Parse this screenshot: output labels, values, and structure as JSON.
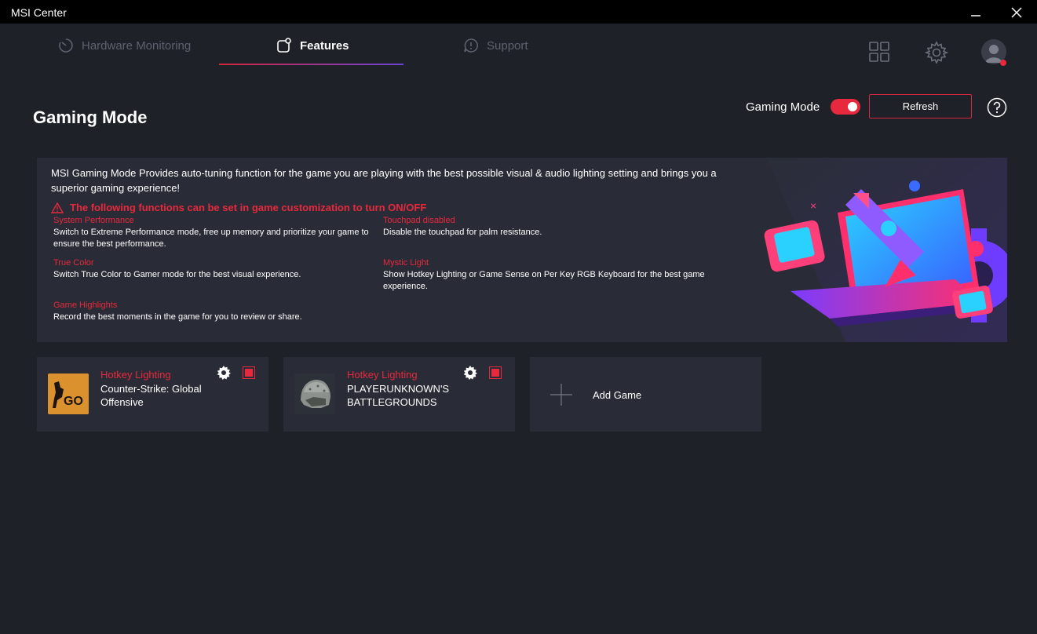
{
  "window": {
    "title": "MSI Center"
  },
  "nav": {
    "tabs": [
      {
        "label": "Hardware Monitoring",
        "active": false
      },
      {
        "label": "Features",
        "active": true
      },
      {
        "label": "Support",
        "active": false
      }
    ]
  },
  "page": {
    "title": "Gaming Mode",
    "toggle_label": "Gaming Mode",
    "toggle_on": true,
    "refresh_label": "Refresh"
  },
  "info": {
    "description": "MSI Gaming Mode Provides auto-tuning function for the game you are playing with the best possible visual & audio lighting setting and brings you a superior gaming experience!",
    "warning": "The following functions can be set in game customization to turn ON/OFF",
    "features": [
      {
        "title": "System Performance",
        "desc": "Switch to Extreme Performance mode, free up memory and prioritize your game to ensure the best performance."
      },
      {
        "title": "Touchpad disabled",
        "desc": "Disable the touchpad for palm resistance."
      },
      {
        "title": "True Color",
        "desc": "Switch True Color to Gamer mode for the best visual experience."
      },
      {
        "title": "Mystic Light",
        "desc": "Show Hotkey Lighting or Game Sense on Per Key RGB Keyboard for the best game experience."
      },
      {
        "title": "Game Highlights",
        "desc": "Record the best moments in the game for you to review or share."
      }
    ]
  },
  "games": [
    {
      "tag": "Hotkey Lighting",
      "name": "Counter-Strike: Global Offensive",
      "icon": "csgo-logo",
      "logo_text": "GO"
    },
    {
      "tag": "Hotkey Lighting",
      "name": "PLAYERUNKNOWN'S BATTLEGROUNDS",
      "icon": "pubg-helmet"
    }
  ],
  "add_game": {
    "label": "Add Game"
  },
  "colors": {
    "accent": "#e8283c",
    "background": "#1f2129",
    "panel": "#292c36",
    "purple": "#6a44d6"
  }
}
